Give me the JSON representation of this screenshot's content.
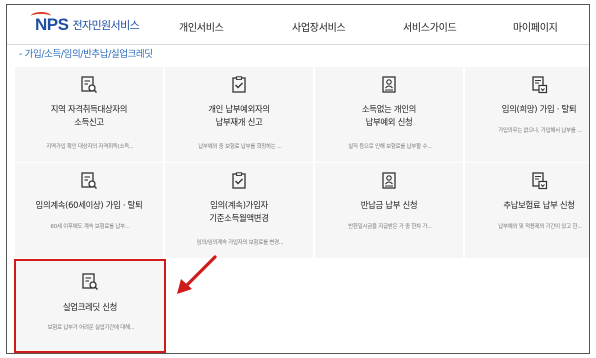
{
  "header": {
    "logo_mark": "NPS",
    "logo_text": "전자민원서비스",
    "nav": [
      "개인서비스",
      "사업장서비스",
      "서비스가이드",
      "마이페이지"
    ]
  },
  "breadcrumb": "- 가입/소득/임의/반추납/실업크레딧",
  "cards": [
    {
      "title1": "지역 자격취득대상자의",
      "title2": "소득신고",
      "desc": "지역가입 확인 대상자의 자격취득(소득...",
      "icon": "document-search-icon"
    },
    {
      "title1": "개인 납부예외자의",
      "title2": "납부재개 신고",
      "desc": "납부예외 중 보험료 납부를 희망하는 ...",
      "icon": "clipboard-check-icon"
    },
    {
      "title1": "소득없는 개인의",
      "title2": "납부예외 신청",
      "desc": "실직 등으로 인해 보험료를 납부할 수...",
      "icon": "person-document-icon"
    },
    {
      "title1": "임의(희망) 가입 · 탈퇴",
      "title2": "",
      "desc": "가입의무는 없으나, 가입해서 납부를 ...",
      "icon": "document-download-icon"
    },
    {
      "title1": "임의계속(60세이상) 가입 · 탈퇴",
      "title2": "",
      "desc": "60세 이후에도 계속 보험료를 납부...",
      "icon": "document-search-icon"
    },
    {
      "title1": "임의(계속)가입자",
      "title2": "기준소득월액변경",
      "desc": "임의/임의계속 가입자의 보험료를 변경...",
      "icon": "clipboard-check-icon"
    },
    {
      "title1": "반납금 납부 신청",
      "title2": "",
      "desc": "반환일시금을 지급받은 가 중 한차 가...",
      "icon": "person-document-icon"
    },
    {
      "title1": "추납보험료 납부 신청",
      "title2": "",
      "desc": "납부예외 및 적용제외 기간이 있고 한...",
      "icon": "document-download-icon"
    },
    {
      "title1": "실업크레딧 신청",
      "title2": "",
      "desc": "보험료 납부가 어려운 실업기간에 대해...",
      "icon": "document-search-icon"
    }
  ],
  "colors": {
    "accent": "#2b6bbb",
    "highlight": "#d11a1a",
    "card_bg": "#f6f6f6",
    "logo_red": "#e23b2d",
    "logo_blue": "#1d4fa3"
  }
}
